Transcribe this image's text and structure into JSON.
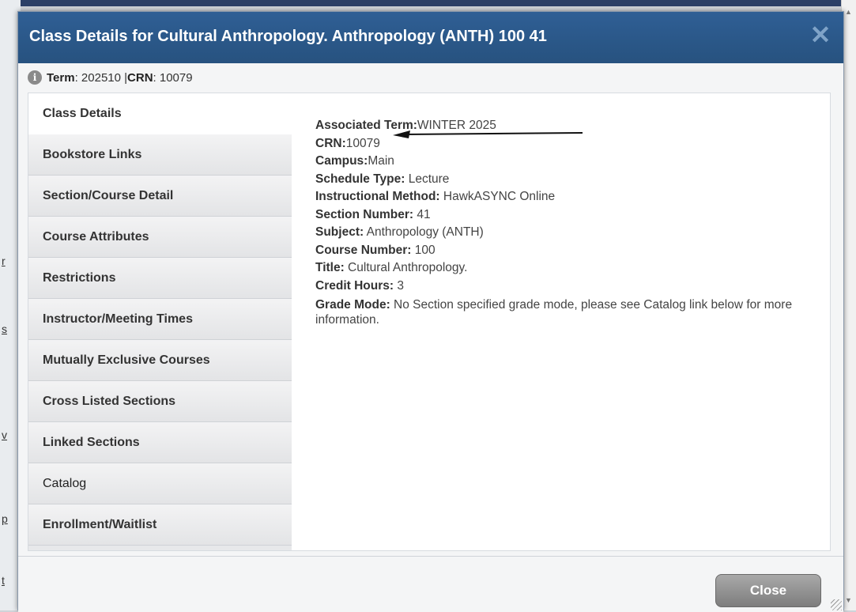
{
  "background": {
    "fragments": [
      "r",
      "s",
      "v",
      "p",
      "t"
    ]
  },
  "dialog": {
    "title": "Class Details for Cultural Anthropology. Anthropology (ANTH) 100 41",
    "close_icon": "close-icon",
    "term_label": "Term",
    "term_value": ": 202510 | ",
    "crn_label": "CRN",
    "crn_value": ": 10079",
    "info_icon": "i"
  },
  "tabs": [
    {
      "label": "Class Details"
    },
    {
      "label": "Bookstore Links"
    },
    {
      "label": "Section/Course Detail"
    },
    {
      "label": "Course Attributes"
    },
    {
      "label": "Restrictions"
    },
    {
      "label": "Instructor/Meeting Times"
    },
    {
      "label": "Mutually Exclusive Courses"
    },
    {
      "label": "Cross Listed Sections"
    },
    {
      "label": "Linked Sections"
    },
    {
      "label": "Catalog"
    },
    {
      "label": "Enrollment/Waitlist"
    }
  ],
  "details": [
    {
      "label": "Associated Term:",
      "value": "WINTER 2025"
    },
    {
      "label": "CRN:",
      "value": "10079"
    },
    {
      "label": "Campus:",
      "value": "Main"
    },
    {
      "label": "Schedule Type:",
      "value": " Lecture"
    },
    {
      "label": "Instructional Method:",
      "value": " HawkASYNC Online"
    },
    {
      "label": "Section Number:",
      "value": " 41"
    },
    {
      "label": "Subject:",
      "value": " Anthropology (ANTH)"
    },
    {
      "label": "Course Number:",
      "value": " 100"
    },
    {
      "label": "Title:",
      "value": " Cultural Anthropology."
    },
    {
      "label": "Credit Hours:",
      "value": " 3"
    },
    {
      "label": "Grade Mode:",
      "value": " No Section specified grade mode, please see Catalog link below for more information."
    }
  ],
  "footer": {
    "close_label": "Close"
  }
}
